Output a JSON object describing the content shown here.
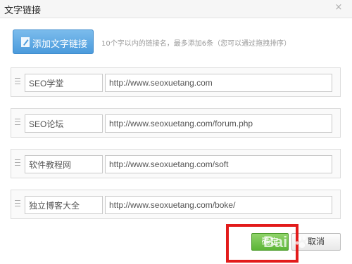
{
  "dialog": {
    "title": "文字链接",
    "close_glyph": "×"
  },
  "toolbar": {
    "add_label": "添加文字链接",
    "hint": "10个字以内的链接名，最多添加6条（您可以通过拖拽排序）"
  },
  "links": [
    {
      "name": "SEO学堂",
      "url": "http://www.seoxuetang.com"
    },
    {
      "name": "SEO论坛",
      "url": "http://www.seoxuetang.com/forum.php"
    },
    {
      "name": "软件教程网",
      "url": "http://www.seoxuetang.com/soft"
    },
    {
      "name": "独立博客大全",
      "url": "http://www.seoxuetang.com/boke/"
    }
  ],
  "footer": {
    "ok_label": "确定",
    "cancel_label": "取消"
  },
  "watermark": {
    "text": "Bai"
  },
  "colors": {
    "add_button": "#4b9bdc",
    "ok_button": "#5cb536",
    "highlight_box": "#e21b1b"
  }
}
